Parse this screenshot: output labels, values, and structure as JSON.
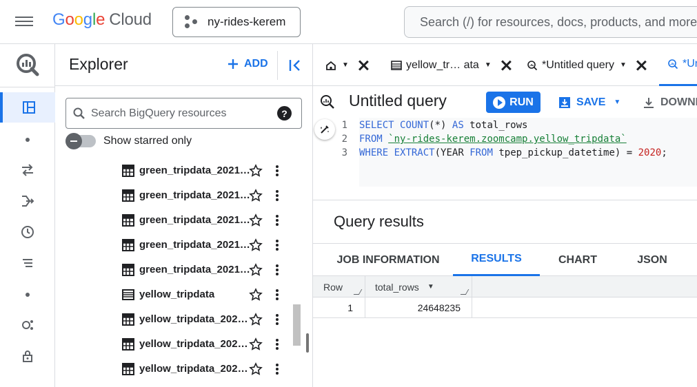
{
  "topbar": {
    "logo_google": [
      "G",
      "o",
      "o",
      "g",
      "l",
      "e"
    ],
    "logo_cloud": "Cloud",
    "project_name": "ny-rides-kerem",
    "search_placeholder": "Search (/) for resources, docs, products, and more"
  },
  "rail": {
    "items": [
      "bigquery-logo",
      "studio-icon",
      "transfers-icon",
      "pipelines-icon",
      "scheduled-queries-icon",
      "table-list-icon",
      "analytics-hub-icon",
      "lock-icon"
    ]
  },
  "explorer": {
    "title": "Explorer",
    "add_label": "ADD",
    "search_placeholder": "Search BigQuery resources",
    "help_glyph": "?",
    "toggle_label": "Show starred only",
    "rows": [
      {
        "name": "green_tripdata_2021…",
        "icon": "table-icon"
      },
      {
        "name": "green_tripdata_2021…",
        "icon": "table-icon"
      },
      {
        "name": "green_tripdata_2021…",
        "icon": "table-icon"
      },
      {
        "name": "green_tripdata_2021…",
        "icon": "table-icon"
      },
      {
        "name": "green_tripdata_2021…",
        "icon": "table-icon"
      },
      {
        "name": "yellow_tripdata",
        "icon": "external-table-icon"
      },
      {
        "name": "yellow_tripdata_202…",
        "icon": "table-icon"
      },
      {
        "name": "yellow_tripdata_202…",
        "icon": "table-icon"
      },
      {
        "name": "yellow_tripdata_202…",
        "icon": "table-icon"
      }
    ]
  },
  "tabs": [
    {
      "label": "",
      "icon": "home-icon"
    },
    {
      "label": "yellow_tr… ata",
      "icon": "table-icon"
    },
    {
      "label": "*Untitled query",
      "icon": "query-icon"
    },
    {
      "label": "*Ur",
      "icon": "query-icon"
    }
  ],
  "query": {
    "title": "Untitled query",
    "run_label": "RUN",
    "save_label": "SAVE",
    "download_label": "DOWNL",
    "line_numbers": [
      "1",
      "2",
      "3"
    ],
    "line1": {
      "kw1": "SELECT",
      "fn": "COUNT",
      "rest": "(*) ",
      "kw2": "AS",
      "tail": " total_rows"
    },
    "line2": {
      "kw": "FROM",
      "str": "`ny-rides-kerem.zoomcamp.yellow_tripdata`"
    },
    "line3": {
      "kw": "WHERE",
      "fn": "EXTRACT",
      "p1": "(YEAR ",
      "kw2": "FROM",
      "p2": " tpep_pickup_datetime) = ",
      "num": "2020",
      "end": ";"
    }
  },
  "results": {
    "title": "Query results",
    "tabs": [
      "JOB INFORMATION",
      "RESULTS",
      "CHART",
      "JSON"
    ],
    "active_tab": "RESULTS",
    "columns": [
      "Row",
      "total_rows"
    ],
    "rows": [
      [
        "1",
        "24648235"
      ]
    ]
  },
  "colors": {
    "accent": "#1a73e8",
    "green": "#188038",
    "red": "#c5221f"
  }
}
